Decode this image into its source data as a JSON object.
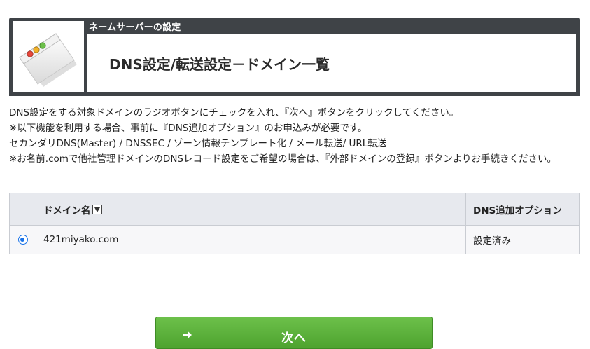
{
  "header": {
    "section_title": "ネームサーバーの設定",
    "title": "DNS設定/転送設定－ドメイン一覧",
    "icon": "app-window-icon"
  },
  "instructions": {
    "line1": "DNS設定をする対象ドメインのラジオボタンにチェックを入れ、『次へ』ボタンをクリックしてください。",
    "line2": "※以下機能を利用する場合、事前に『DNS追加オプション』のお申込みが必要です。",
    "line3": "セカンダリDNS(Master) / DNSSEC / ゾーン情報テンプレート化 / メール転送/ URL転送",
    "line4": "※お名前.comで他社管理ドメインのDNSレコード設定をご希望の場合は、『外部ドメインの登録』ボタンよりお手続きください。"
  },
  "table": {
    "columns": [
      "",
      "ドメイン名",
      "DNS追加オプション"
    ],
    "sort_icon": "sort-down-icon",
    "rows": [
      {
        "selected": true,
        "domain": "421miyako.com",
        "option_status": "設定済み"
      }
    ]
  },
  "next_button": {
    "label": "次へ",
    "icon": "arrow-right-icon"
  },
  "colors": {
    "header_bg": "#3f4347",
    "button_green": "#5bb03a",
    "radio_blue": "#1a73e8",
    "table_header_bg": "#e7e9ee"
  }
}
